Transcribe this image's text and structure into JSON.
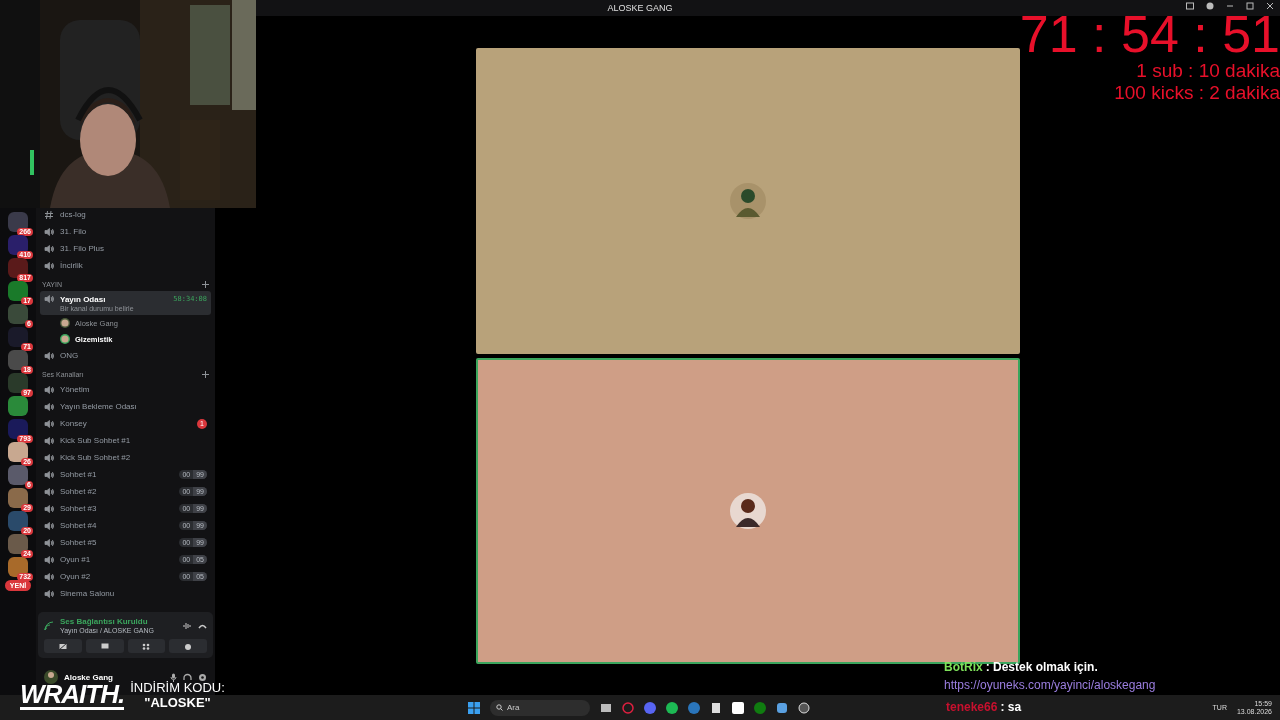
{
  "window": {
    "title": "ALOSKE GANG"
  },
  "server_rail": [
    {
      "kind": "server",
      "badge": "266"
    },
    {
      "kind": "server",
      "badge": "410"
    },
    {
      "kind": "server",
      "badge": "817"
    },
    {
      "kind": "server",
      "badge": "17"
    },
    {
      "kind": "server",
      "badge": "6"
    },
    {
      "kind": "server",
      "badge": "71"
    },
    {
      "kind": "server",
      "badge": "18"
    },
    {
      "kind": "server",
      "badge": "97"
    },
    {
      "kind": "server"
    },
    {
      "kind": "server",
      "badge": "793"
    },
    {
      "kind": "server",
      "badge": "26"
    },
    {
      "kind": "server",
      "badge": "6"
    },
    {
      "kind": "server",
      "badge": "29"
    },
    {
      "kind": "server",
      "badge": "20"
    },
    {
      "kind": "server",
      "badge": "24"
    },
    {
      "kind": "server",
      "badge": "732"
    },
    {
      "kind": "new",
      "badge": "YENİ"
    }
  ],
  "channel_groups": [
    {
      "items": [
        {
          "kind": "text",
          "name": "dcs-log",
          "selected": false
        },
        {
          "kind": "voice",
          "name": "31. Filo",
          "selected": false
        },
        {
          "kind": "voice",
          "name": "31. Filo Plus",
          "selected": false
        },
        {
          "kind": "voice",
          "name": "İncirlik",
          "selected": false
        }
      ]
    },
    {
      "header": "YAYIN",
      "items": [
        {
          "kind": "voice",
          "name": "Yayın Odası",
          "selected": true,
          "timer": "58:34:08",
          "status": "Bir kanal durumu belirle",
          "members": [
            {
              "name": "Aloske Gang",
              "speaking": false
            },
            {
              "name": "Gizemistik",
              "speaking": true
            }
          ]
        },
        {
          "kind": "voice",
          "name": "ONG",
          "selected": false
        }
      ]
    },
    {
      "header": "Ses Kanalları",
      "items": [
        {
          "kind": "voice",
          "name": "Yönetim",
          "selected": false
        },
        {
          "kind": "voice",
          "name": "Yayın Bekleme Odası",
          "selected": false
        },
        {
          "kind": "voice",
          "name": "Konsey",
          "selected": false,
          "badge": "1"
        },
        {
          "kind": "voice",
          "name": "Kick Sub Sohbet #1",
          "selected": false
        },
        {
          "kind": "voice",
          "name": "Kick Sub Sohbet #2",
          "selected": false
        },
        {
          "kind": "voice",
          "name": "Sohbet #1",
          "selected": false,
          "limit": [
            "00",
            "99"
          ]
        },
        {
          "kind": "voice",
          "name": "Sohbet #2",
          "selected": false,
          "limit": [
            "00",
            "99"
          ]
        },
        {
          "kind": "voice",
          "name": "Sohbet #3",
          "selected": false,
          "limit": [
            "00",
            "99"
          ]
        },
        {
          "kind": "voice",
          "name": "Sohbet #4",
          "selected": false,
          "limit": [
            "00",
            "99"
          ]
        },
        {
          "kind": "voice",
          "name": "Sohbet #5",
          "selected": false,
          "limit": [
            "00",
            "99"
          ]
        },
        {
          "kind": "voice",
          "name": "Oyun #1",
          "selected": false,
          "limit": [
            "00",
            "05"
          ]
        },
        {
          "kind": "voice",
          "name": "Oyun #2",
          "selected": false,
          "limit": [
            "00",
            "05"
          ]
        },
        {
          "kind": "voice",
          "name": "Sinema Salonu",
          "selected": false
        }
      ]
    }
  ],
  "voice_panel": {
    "status": "Ses Bağlantısı Kuruldu",
    "channel": "Yayın Odası / ALOSKE GANG"
  },
  "user_panel": {
    "name": "Aloske Gang"
  },
  "tiles": [
    {
      "color": "#b8a27a",
      "speaking": false
    },
    {
      "color": "#cf9e86",
      "speaking": true
    }
  ],
  "timer_overlay": {
    "time": "71 : 54 : 51",
    "rules": [
      "1 sub : 10 dakika",
      "100 kicks : 2 dakika"
    ]
  },
  "chat": [
    {
      "user": "BotRix",
      "color": "#7ee05a",
      "text": ": Destek olmak için.",
      "link": "https://oyuneks.com/yayinci/aloskegang"
    },
    {
      "user": "teneke66",
      "color": "#c8102e",
      "text": ": sa"
    }
  ],
  "sponsor": {
    "brand": "WRAITH.",
    "code_label": "İNDİRİM KODU:",
    "code": "\"ALOSKE\""
  },
  "taskbar": {
    "search_placeholder": "Ara",
    "language": "TUR",
    "time": "15:59",
    "date": "13.08.2026"
  }
}
